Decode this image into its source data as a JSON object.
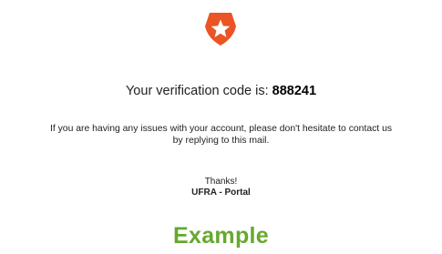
{
  "logo": {
    "icon": "auth0-star-shield-icon",
    "color": "#eb5424"
  },
  "message": {
    "code_prefix": "Your verification code is:",
    "code": "888241",
    "help_line1": "If you are having any issues with your account, please don't hesitate to contact us",
    "help_line2": "by replying to this mail.",
    "thanks": "Thanks!",
    "sender": "UFRA - Portal"
  },
  "caption": {
    "text": "Example",
    "color": "#66a82f"
  }
}
